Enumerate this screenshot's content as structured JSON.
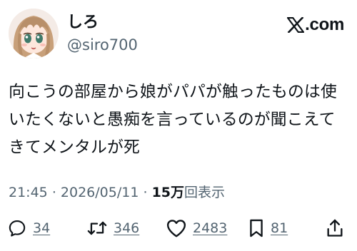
{
  "author": {
    "display_name": "しろ",
    "handle": "@siro700",
    "avatar": "anime-girl-avatar"
  },
  "brand": {
    "icon": "x-logo-icon",
    "text": ".com"
  },
  "tweet": {
    "text": "向こうの部屋から娘がパパが触ったものは使いたくないと愚痴を言っているのが聞こえてきてメンタルが死"
  },
  "meta": {
    "time": "21:45",
    "separator_1": "·",
    "date": "2026/05/11",
    "separator_2": "·",
    "views_count": "15万",
    "views_label": "回表示"
  },
  "actions": {
    "reply": {
      "icon": "reply-bubble-icon",
      "count": "34"
    },
    "retweet": {
      "icon": "retweet-icon",
      "count": "346"
    },
    "like": {
      "icon": "heart-icon",
      "count": "2483"
    },
    "bookmark": {
      "icon": "bookmark-icon",
      "count": "81"
    },
    "share": {
      "icon": "share-icon"
    }
  },
  "colors": {
    "text_primary": "#0f1419",
    "text_secondary": "#536471",
    "background": "#ffffff"
  }
}
